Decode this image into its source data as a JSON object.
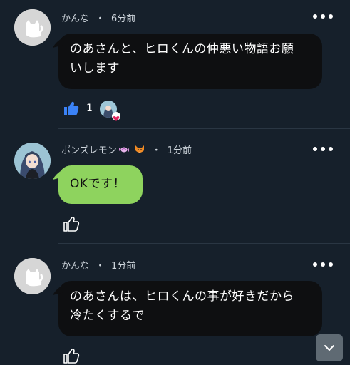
{
  "comments": [
    {
      "author": "かんな",
      "separator": "・",
      "time": "6分前",
      "text_lines": [
        "のあさんと、ヒロくんの仲悪い物語お願",
        "いします"
      ],
      "like_count": "1",
      "avatar": "cat-placeholder-icon"
    },
    {
      "author": "ポンズレモン",
      "author_emojis": [
        "candy-icon",
        "fox-icon"
      ],
      "separator": "・",
      "time": "1分前",
      "text_lines": [
        "OKです！"
      ],
      "avatar": "anime-girl-avatar"
    },
    {
      "author": "かんな",
      "separator": "・",
      "time": "1分前",
      "text_lines": [
        "のあさんは、ヒロくんの事が好きだから",
        "冷たくするで"
      ],
      "avatar": "cat-placeholder-icon"
    }
  ],
  "colors": {
    "background": "#16202b",
    "bubble_dark": "#0e0f11",
    "bubble_green": "#8ed35e",
    "like_blue": "#3b82f6"
  }
}
